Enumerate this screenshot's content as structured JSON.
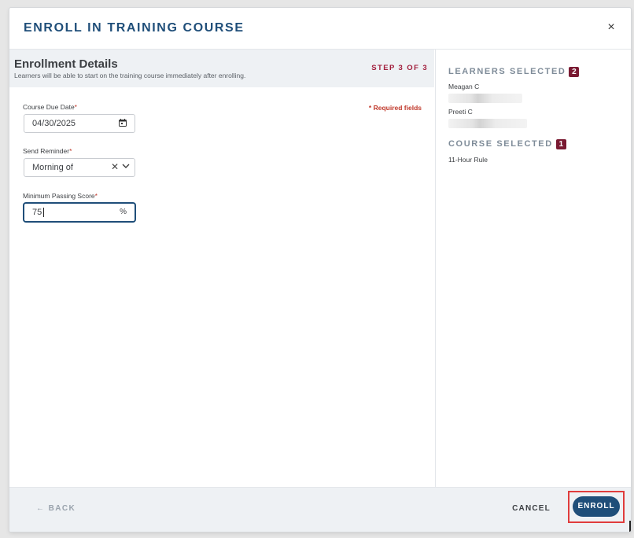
{
  "modal": {
    "title": "ENROLL IN TRAINING COURSE",
    "close_icon": "×"
  },
  "enrollment": {
    "title": "Enrollment Details",
    "subtitle": "Learners will be able to start on the training course immediately after enrolling.",
    "step": "STEP 3 OF 3",
    "required_note": "* Required fields",
    "fields": {
      "due_date": {
        "label": "Course Due Date",
        "required_mark": "*",
        "value": "04/30/2025"
      },
      "reminder": {
        "label": "Send Reminder",
        "required_mark": "*",
        "value": "Morning of",
        "clear_icon": "✕"
      },
      "passing_score": {
        "label": "Minimum Passing Score",
        "required_mark": "*",
        "value": "75",
        "unit": "%"
      }
    }
  },
  "sidebar": {
    "learners_heading": "LEARNERS SELECTED",
    "learners_count": "2",
    "learners": [
      "Meagan C",
      "Preeti C"
    ],
    "course_heading": "COURSE SELECTED",
    "course_count": "1",
    "courses": [
      "11-Hour Rule"
    ]
  },
  "footer": {
    "back_label": "← BACK",
    "cancel_label": "CANCEL",
    "enroll_label": "ENROLL"
  },
  "colors": {
    "brand_navy": "#1f4e79",
    "accent_maroon": "#7a1a32",
    "required_red": "#c0392b",
    "highlight_red": "#e03c3c"
  }
}
